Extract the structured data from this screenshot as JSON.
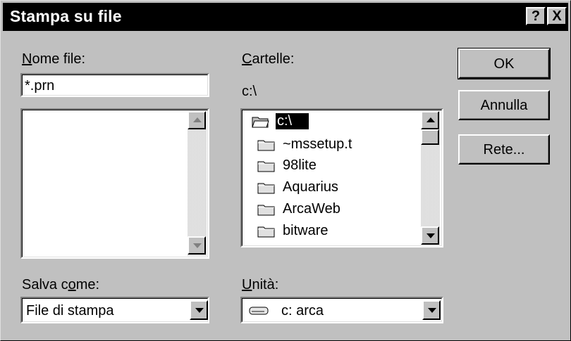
{
  "window": {
    "title": "Stampa su file",
    "help_button": "?",
    "close_button": "X"
  },
  "filename": {
    "label": "Nome file:",
    "value": "*.prn"
  },
  "folders": {
    "label": "Cartelle:",
    "current_path": "c:\\",
    "items": [
      {
        "name": "c:\\",
        "icon": "open-folder-icon",
        "selected": true
      },
      {
        "name": "~mssetup.t",
        "icon": "folder-icon"
      },
      {
        "name": "98lite",
        "icon": "folder-icon"
      },
      {
        "name": "Aquarius",
        "icon": "folder-icon"
      },
      {
        "name": "ArcaWeb",
        "icon": "folder-icon"
      },
      {
        "name": "bitware",
        "icon": "folder-icon"
      }
    ]
  },
  "save_as": {
    "label": "Salva come:",
    "value": "File di stampa"
  },
  "drive": {
    "label": "Unità:",
    "value": "c: arca",
    "icon": "drive-icon"
  },
  "buttons": {
    "ok": "OK",
    "cancel": "Annulla",
    "network": "Rete..."
  },
  "colors": {
    "face": "#c0c0c0",
    "title_bar": "#000000",
    "selection": "#000000"
  }
}
